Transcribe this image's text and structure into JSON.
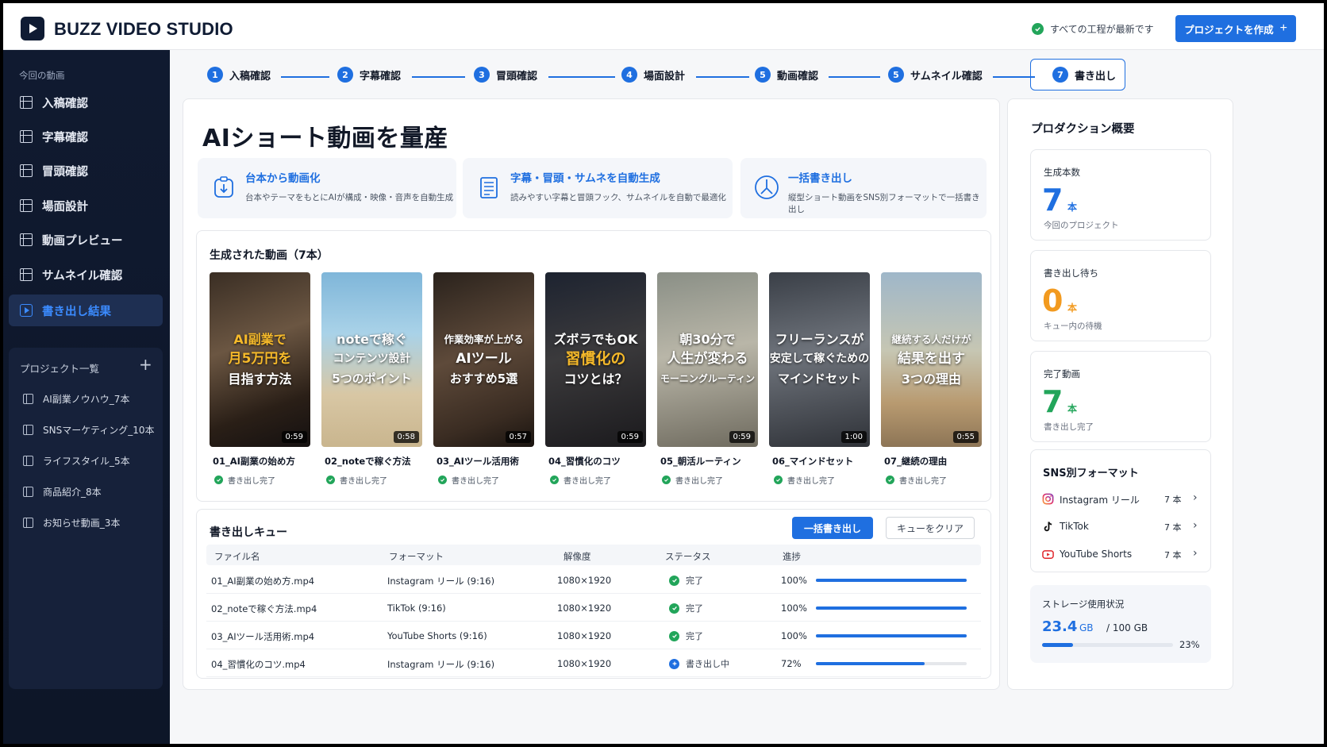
{
  "app": {
    "brand": "BUZZ VIDEO STUDIO",
    "status": "すべての工程が最新です",
    "new_project": "プロジェクトを作成"
  },
  "sidebar": {
    "section_label": "今回の動画",
    "items": [
      {
        "label": "入稿確認"
      },
      {
        "label": "字幕確認"
      },
      {
        "label": "冒頭確認"
      },
      {
        "label": "場面設計"
      },
      {
        "label": "動画プレビュー"
      },
      {
        "label": "サムネイル確認"
      },
      {
        "label": "書き出し結果",
        "active": true
      }
    ],
    "projects_title": "プロジェクト一覧",
    "projects_add": "+",
    "projects": [
      "AI副業ノウハウ_7本",
      "SNSマーケティング_10本",
      "ライフスタイル_5本",
      "商品紹介_8本",
      "お知らせ動画_3本"
    ]
  },
  "stepper": [
    {
      "num": "1",
      "label": "入稿確認"
    },
    {
      "num": "2",
      "label": "字幕確認"
    },
    {
      "num": "3",
      "label": "冒頭確認"
    },
    {
      "num": "4",
      "label": "場面設計"
    },
    {
      "num": "5",
      "label": "動画確認"
    },
    {
      "num": "5",
      "label": "サムネイル確認"
    },
    {
      "num": "7",
      "label": "書き出し",
      "current": true
    }
  ],
  "main": {
    "title": "AIショート動画を量産",
    "features": [
      {
        "title": "台本から動画化",
        "desc": "台本やテーマをもとにAIが構成・映像・音声を自動生成",
        "icon": "download-clipboard-icon"
      },
      {
        "title": "字幕・冒頭・サムネを自動生成",
        "desc": "読みやすい字幕と冒頭フック、サムネイルを自動で最適化",
        "icon": "document-list-icon"
      },
      {
        "title": "一括書き出し",
        "desc": "縦型ショート動画をSNS別フォーマットで一括書き出し",
        "icon": "share-arrows-icon"
      }
    ],
    "videos_title": "生成された動画（7本）",
    "videos": [
      {
        "cap1": "AI副業で",
        "cap2": "月5万円を",
        "cap3": "目指す方法",
        "duration": "0:59",
        "name": "01_AI副業の始め方",
        "status": "書き出し完了"
      },
      {
        "cap1": "noteで稼ぐ",
        "cap2": "コンテンツ設計",
        "cap3": "5つのポイント",
        "duration": "0:58",
        "name": "02_noteで稼ぐ方法",
        "status": "書き出し完了"
      },
      {
        "cap1": "作業効率が上がる",
        "cap2": "AIツール",
        "cap3": "おすすめ5選",
        "duration": "0:57",
        "name": "03_AIツール活用術",
        "status": "書き出し完了"
      },
      {
        "cap1": "ズボラでもOK",
        "cap2": "習慣化の",
        "cap3": "コツとは？",
        "duration": "0:59",
        "name": "04_習慣化のコツ",
        "status": "書き出し完了"
      },
      {
        "cap1": "朝30分で",
        "cap2": "人生が変わる",
        "cap3": "モーニングルーティン",
        "duration": "0:59",
        "name": "05_朝活ルーティン",
        "status": "書き出し完了"
      },
      {
        "cap1": "フリーランスが",
        "cap2": "安定して稼ぐための",
        "cap3": "マインドセット",
        "duration": "1:00",
        "name": "06_マインドセット",
        "status": "書き出し完了"
      },
      {
        "cap1": "継続する人だけが",
        "cap2": "結果を出す",
        "cap3": "3つの理由",
        "duration": "0:55",
        "name": "07_継続の理由",
        "status": "書き出し完了"
      }
    ],
    "queue": {
      "title": "書き出しキュー",
      "export_all": "一括書き出し",
      "clear": "キューをクリア",
      "headers": [
        "ファイル名",
        "フォーマット",
        "解像度",
        "ステータス",
        "進捗"
      ],
      "rows": [
        {
          "file": "01_AI副業の始め方.mp4",
          "format": "Instagram リール (9:16)",
          "res": "1080×1920",
          "status": "完了",
          "progress": "100%",
          "pct": 100,
          "done": true
        },
        {
          "file": "02_noteで稼ぐ方法.mp4",
          "format": "TikTok (9:16)",
          "res": "1080×1920",
          "status": "完了",
          "progress": "100%",
          "pct": 100,
          "done": true
        },
        {
          "file": "03_AIツール活用術.mp4",
          "format": "YouTube Shorts (9:16)",
          "res": "1080×1920",
          "status": "完了",
          "progress": "100%",
          "pct": 100,
          "done": true
        },
        {
          "file": "04_習慣化のコツ.mp4",
          "format": "Instagram リール (9:16)",
          "res": "1080×1920",
          "status": "書き出し中",
          "progress": "72%",
          "pct": 72,
          "done": false
        }
      ]
    }
  },
  "right": {
    "title": "プロダクション概要",
    "stats": [
      {
        "label": "生成本数",
        "value": "7",
        "unit": "本",
        "sub": "今回のプロジェクト",
        "color": "#1f6fe0"
      },
      {
        "label": "書き出し待ち",
        "value": "0",
        "unit": "本",
        "sub": "キュー内の待機",
        "color": "#f29a1f"
      },
      {
        "label": "完了動画",
        "value": "7",
        "unit": "本",
        "sub": "書き出し完了",
        "color": "#22a55a"
      }
    ],
    "sns": {
      "title": "SNS別フォーマット",
      "items": [
        {
          "name": "Instagram リール",
          "count": "7 本",
          "icon": "instagram-icon"
        },
        {
          "name": "TikTok",
          "count": "7 本",
          "icon": "tiktok-icon"
        },
        {
          "name": "YouTube Shorts",
          "count": "7 本",
          "icon": "youtube-icon"
        }
      ]
    },
    "storage": {
      "title": "ストレージ使用状況",
      "used": "23.4",
      "unit": "GB",
      "total": "/ 100 GB",
      "percent": "23%",
      "fraction": 0.234
    }
  },
  "colors": {
    "accent": "#1f6fe0",
    "sidebar": "#101a30",
    "success": "#22a55a",
    "warning": "#f29a1f"
  }
}
